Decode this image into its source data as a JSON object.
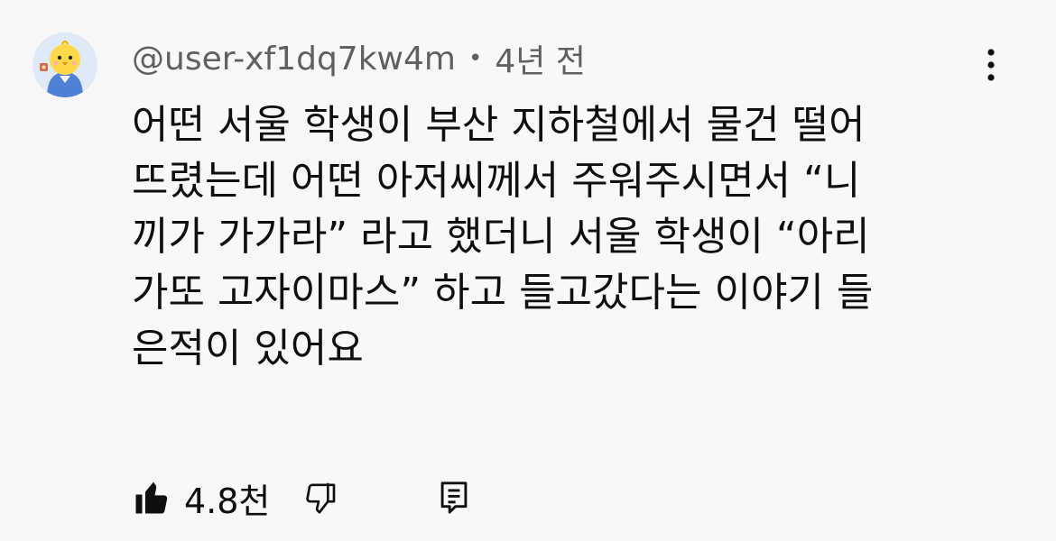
{
  "comment": {
    "author": "@user-xf1dq7kw4m",
    "separator": "•",
    "time": "4년 전",
    "text": "어떤 서울 학생이 부산 지하철에서 물건 떨어\n뜨렸는데 어떤 아저씨께서 주워주시면서 “니\n끼가 가가라” 라고 했더니 서울 학생이 “아리\n가또 고자이마스” 하고 들고갔다는 이야기 들\n은적이 있어요",
    "like_count": "4.8천"
  },
  "icons": {
    "avatar": "chick-avatar",
    "more": "vertical-ellipsis-icon",
    "like": "thumbs-up-filled-icon",
    "dislike": "thumbs-down-outline-icon",
    "reply": "comment-reply-icon"
  },
  "colors": {
    "background": "#f8f8f8",
    "text_primary": "#0f0f0f",
    "text_secondary": "#606060",
    "avatar_background": "#dfeaf7"
  }
}
